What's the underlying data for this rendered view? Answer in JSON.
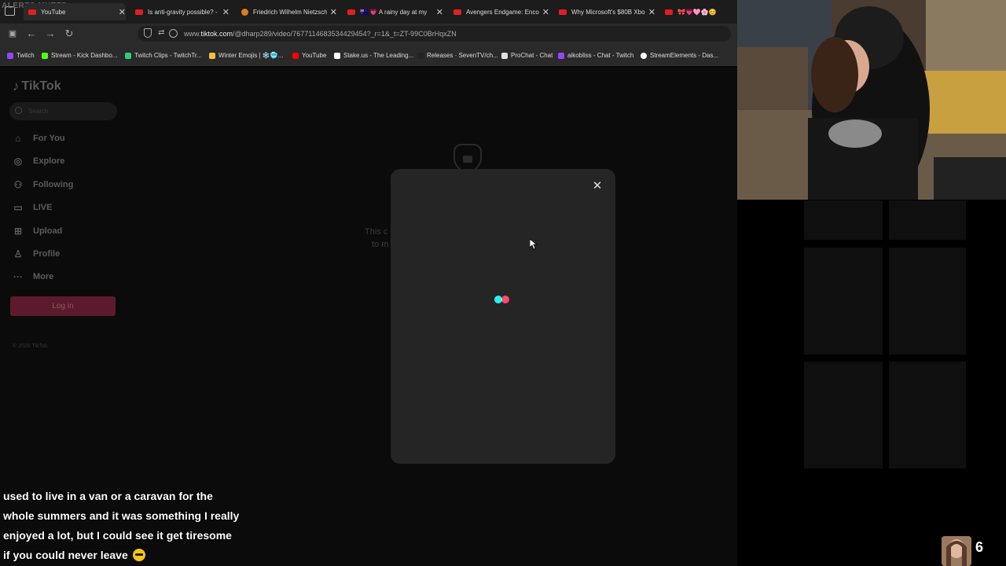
{
  "stream_overlay": {
    "alerts_muted": "ALERTS MUTED",
    "captions": [
      "used to live in a van or a caravan for the",
      "whole summers and it was something I really",
      "enjoyed a lot, but I could see it get tiresome",
      "if you could never leave"
    ],
    "viewer_count": "6"
  },
  "browser": {
    "tabs": [
      {
        "title": "YouTube",
        "icon": "youtube-icon",
        "active": true
      },
      {
        "title": "Is anti-gravity possible? - Y",
        "icon": "youtube-icon"
      },
      {
        "title": "Friedrich Wilhelm Nietzsch",
        "icon": "wiki-icon"
      },
      {
        "title": "🇦🇺 💗 A rainy day at my",
        "icon": "youtube-icon"
      },
      {
        "title": "Avengers Endgame: Encore",
        "icon": "youtube-icon"
      },
      {
        "title": "Why Microsoft's $80B Xbo",
        "icon": "youtube-icon"
      },
      {
        "title": "🎀💗🩷🌸😊",
        "icon": "youtube-icon"
      }
    ],
    "url_prefix": "www.",
    "url_domain": "tiktok.com",
    "url_rest": "/@dharp289/video/7677114683534429454?_r=1&_t=ZT-99C0BrHqxZN",
    "bookmarks": [
      {
        "label": "Twitch",
        "color": "#9146ff"
      },
      {
        "label": "Stream - Kick Dashbo...",
        "color": "#53fc18"
      },
      {
        "label": "Twitch Clips - TwitchTr...",
        "color": "#26d07c"
      },
      {
        "label": "Winter Emojis | ❄️🥶...",
        "color": "#f0c040"
      },
      {
        "label": "YouTube",
        "color": "#ff0000"
      },
      {
        "label": "Stake.us - The Leading...",
        "color": "#ffffff"
      },
      {
        "label": "Releases · SevenTV/ch...",
        "color": "#222222"
      },
      {
        "label": "ProChat - Chat",
        "color": "#e0e0e0"
      },
      {
        "label": "aikobliss - Chat - Twitch",
        "color": "#9146ff"
      },
      {
        "label": "StreamElements - Das...",
        "color": "#ffffff"
      }
    ]
  },
  "tiktok": {
    "logo": "TikTok",
    "search_placeholder": "Search",
    "nav": [
      {
        "label": "For You",
        "icon": "home-icon"
      },
      {
        "label": "Explore",
        "icon": "compass-icon"
      },
      {
        "label": "Following",
        "icon": "following-icon"
      },
      {
        "label": "LIVE",
        "icon": "live-icon"
      },
      {
        "label": "Upload",
        "icon": "upload-icon"
      },
      {
        "label": "Profile",
        "icon": "profile-icon"
      },
      {
        "label": "More",
        "icon": "more-icon"
      }
    ],
    "login_label": "Log in",
    "copyright": "© 2026 TikTok",
    "private_text_1": "This c",
    "private_text_2": "to m"
  },
  "modal": {
    "close_symbol": "✕",
    "loader_colors": [
      "#25f4ee",
      "#fe2c55"
    ]
  }
}
